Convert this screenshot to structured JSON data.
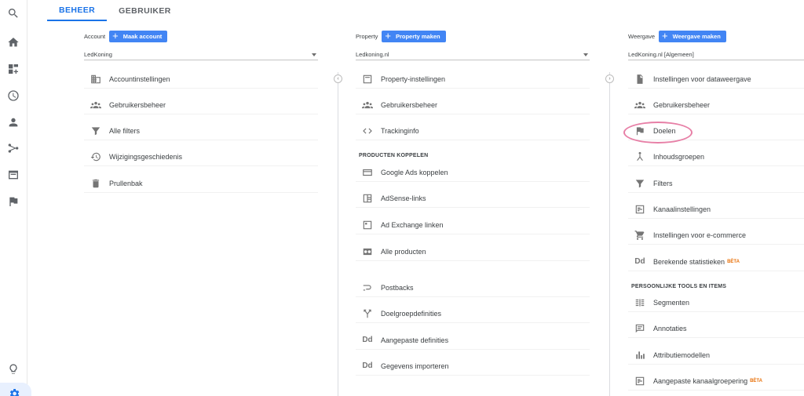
{
  "tabs": [
    {
      "label": "BEHEER"
    },
    {
      "label": "GEBRUIKER"
    }
  ],
  "account": {
    "label": "Account",
    "create_label": "Maak account",
    "selected": "LedKoning",
    "items": [
      {
        "label": "Accountinstellingen"
      },
      {
        "label": "Gebruikersbeheer"
      },
      {
        "label": "Alle filters"
      },
      {
        "label": "Wijzigingsgeschiedenis"
      },
      {
        "label": "Prullenbak"
      }
    ]
  },
  "property": {
    "label": "Property",
    "create_label": "Property maken",
    "selected": "Ledkoning.nl",
    "items": [
      {
        "label": "Property-instellingen"
      },
      {
        "label": "Gebruikersbeheer"
      },
      {
        "label": "Trackinginfo"
      }
    ],
    "section_title": "PRODUCTEN KOPPELEN",
    "products": [
      {
        "label": "Google Ads koppelen"
      },
      {
        "label": "AdSense-links"
      },
      {
        "label": "Ad Exchange linken"
      },
      {
        "label": "Alle producten"
      }
    ],
    "more": [
      {
        "label": "Postbacks"
      },
      {
        "label": "Doelgroepdefinities"
      },
      {
        "label": "Aangepaste definities",
        "icon_text": "Dd"
      },
      {
        "label": "Gegevens importeren",
        "icon_text": "Dd"
      }
    ]
  },
  "view": {
    "label": "Weergave",
    "create_label": "Weergave maken",
    "selected": "LedKoning.nl [Algemeen]",
    "items": [
      {
        "label": "Instellingen voor dataweergave"
      },
      {
        "label": "Gebruikersbeheer"
      },
      {
        "label": "Doelen"
      },
      {
        "label": "Inhoudsgroepen"
      },
      {
        "label": "Filters"
      },
      {
        "label": "Kanaalinstellingen"
      },
      {
        "label": "Instellingen voor e-commerce"
      },
      {
        "label": "Berekende statistieken",
        "badge": "BÈTA",
        "icon_text": "Dd"
      }
    ],
    "section_title": "PERSOONLIJKE TOOLS EN ITEMS",
    "tools": [
      {
        "label": "Segmenten"
      },
      {
        "label": "Annotaties"
      },
      {
        "label": "Attributiemodellen"
      },
      {
        "label": "Aangepaste kanaalgroepering",
        "badge": "BÈTA"
      }
    ]
  },
  "colors": {
    "accent": "#1a73e8",
    "button": "#4285f4",
    "highlight": "#e77fa6",
    "beta": "#e8710a"
  }
}
